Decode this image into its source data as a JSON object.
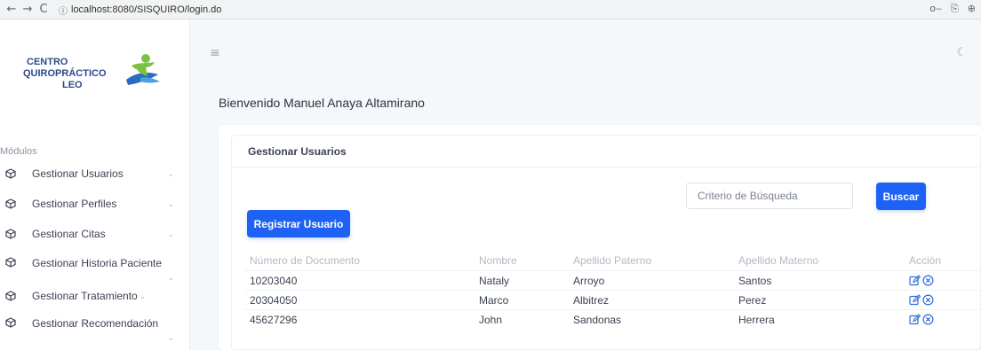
{
  "browser": {
    "back_glyph": "←",
    "forward_glyph": "→",
    "reload_glyph": "C",
    "info_glyph": "ⓘ",
    "url": "localhost:8080/SISQUIRO/login.do",
    "key_glyph": "o‒",
    "translate_glyph": "⎘",
    "zoom_glyph": "⊕"
  },
  "logo": {
    "line1": "CENTRO",
    "line2": "QUIROPRÁCTICO",
    "line3": "LEO"
  },
  "sidebar": {
    "section_title": "Módulos",
    "chevron": "⌄",
    "items": [
      {
        "label": "Gestionar Usuarios"
      },
      {
        "label": "Gestionar Perfiles"
      },
      {
        "label": "Gestionar Citas"
      },
      {
        "label": "Gestionar Historia Paciente"
      },
      {
        "label": "Gestionar Tratamiento"
      },
      {
        "label": "Gestionar Recomendación"
      }
    ]
  },
  "header": {
    "menu_glyph": "≡",
    "theme_glyph": "☾",
    "welcome": "Bienvenido Manuel Anaya Altamirano"
  },
  "card": {
    "title": "Gestionar Usuarios",
    "search_placeholder": "Criterio de Búsqueda",
    "search_button": "Buscar",
    "register_button": "Registrar Usuario"
  },
  "table": {
    "columns": [
      "Número de Documento",
      "Nombre",
      "Apellido Paterno",
      "Apellido Materno",
      "Acción"
    ],
    "rows": [
      [
        "10203040",
        "Nataly",
        "Arroyo",
        "Santos"
      ],
      [
        "20304050",
        "Marco",
        "Albitrez",
        "Perez"
      ],
      [
        "45627296",
        "John",
        "Sandonas",
        "Herrera"
      ]
    ]
  },
  "colors": {
    "primary": "#1e62f5",
    "logo_blue": "#2a4a8c",
    "logo_green": "#7bc142",
    "action_icon": "#2f6ae0"
  }
}
